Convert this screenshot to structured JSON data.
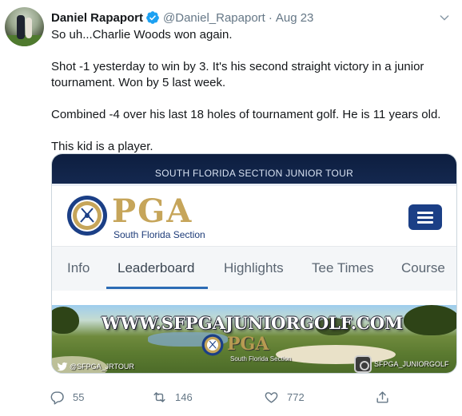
{
  "tweet": {
    "author_name": "Daniel Rapaport",
    "handle": "@Daniel_Rapaport",
    "separator": "·",
    "date": "Aug 23",
    "paragraphs": [
      "So uh...Charlie Woods won again.",
      "Shot -1 yesterday to win by 3. It's his second straight victory in a junior tournament. Won by 5 last week.",
      "Combined -4 over his last 18 holes of tournament golf. He is 11 years old.",
      "This kid is a player."
    ],
    "icons": {
      "verified": "verified-badge-icon",
      "more": "chevron-down-icon",
      "reply": "reply-icon",
      "retweet": "retweet-icon",
      "like": "heart-icon",
      "share": "share-icon"
    },
    "colors": {
      "verified": "#1da1f2",
      "muted": "#657786",
      "text": "#14171a"
    }
  },
  "media": {
    "banner_text": "SOUTH FLORIDA SECTION JUNIOR TOUR",
    "logo_word": "PGA",
    "logo_subtitle": "South Florida Section",
    "tabs": [
      "Info",
      "Leaderboard",
      "Highlights",
      "Tee Times",
      "Course"
    ],
    "active_tab": "Leaderboard",
    "photo_url_text": "WWW.SFPGAJUNIORGOLF.COM",
    "photo_logo_word": "PGA",
    "photo_logo_subtitle": "South Florida Section",
    "twitter_handle": "@SFPGA_JRTOUR",
    "instagram_handle": "SFPGA_JUNIORGOLF",
    "colors": {
      "banner": "#0d1e3f",
      "gold": "#c6a55a",
      "navy": "#1b3f86",
      "tab_underline": "#2c6cb5"
    }
  },
  "actions": {
    "replies": "55",
    "retweets": "146",
    "likes": "772"
  }
}
